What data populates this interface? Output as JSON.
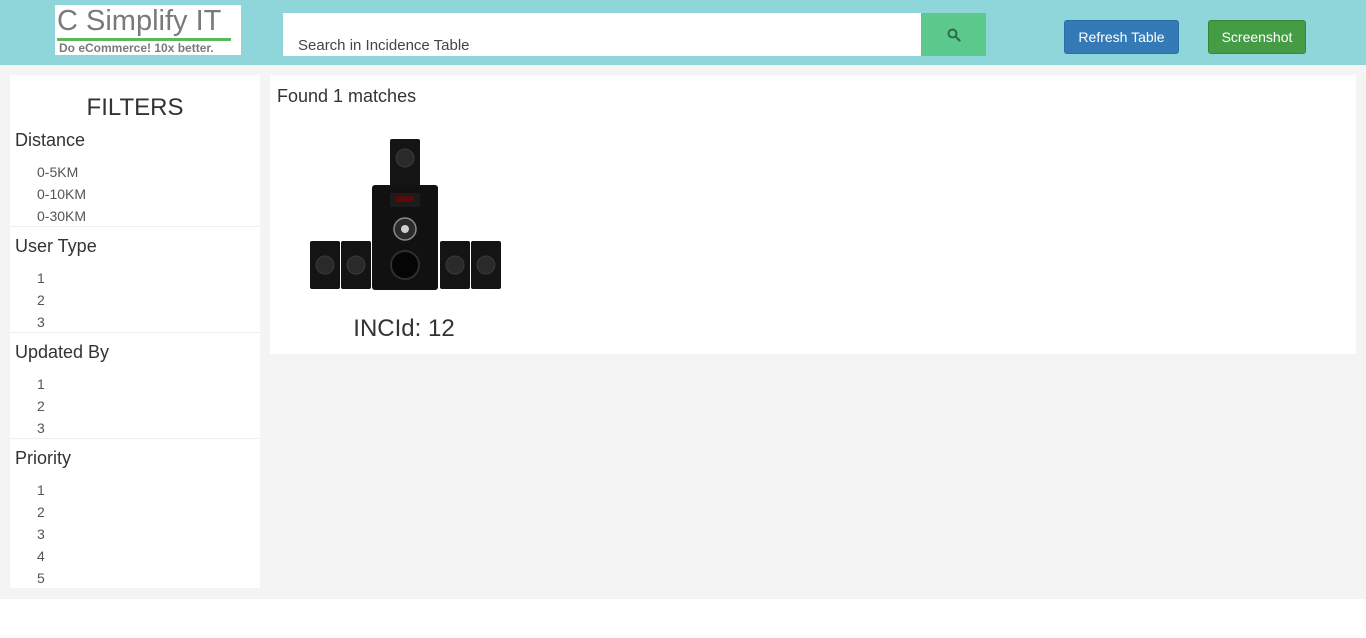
{
  "header": {
    "logo_text": "C Simplify IT",
    "logo_tagline": "Do eCommerce! 10x better.",
    "search_placeholder": "Search in Incidence Table",
    "search_icon": "search-icon",
    "refresh_label": "Refresh Table",
    "screenshot_label": "Screenshot"
  },
  "colors": {
    "topbar": "#8fd6da",
    "search_button": "#5cc98c",
    "refresh_button": "#337ab7",
    "screenshot_button": "#449d44",
    "logo_underline": "#5cb85c"
  },
  "filters": {
    "title": "FILTERS",
    "groups": [
      {
        "title": "Distance",
        "items": [
          "0-5KM",
          "0-10KM",
          "0-30KM"
        ]
      },
      {
        "title": "User Type",
        "items": [
          "1",
          "2",
          "3"
        ]
      },
      {
        "title": "Updated By",
        "items": [
          "1",
          "2",
          "3"
        ]
      },
      {
        "title": "Priority",
        "items": [
          "1",
          "2",
          "3",
          "4",
          "5"
        ]
      }
    ]
  },
  "results": {
    "found_text": "Found 1 matches",
    "items": [
      {
        "image": "speaker-system-image",
        "label": "INCId: 12"
      }
    ]
  }
}
